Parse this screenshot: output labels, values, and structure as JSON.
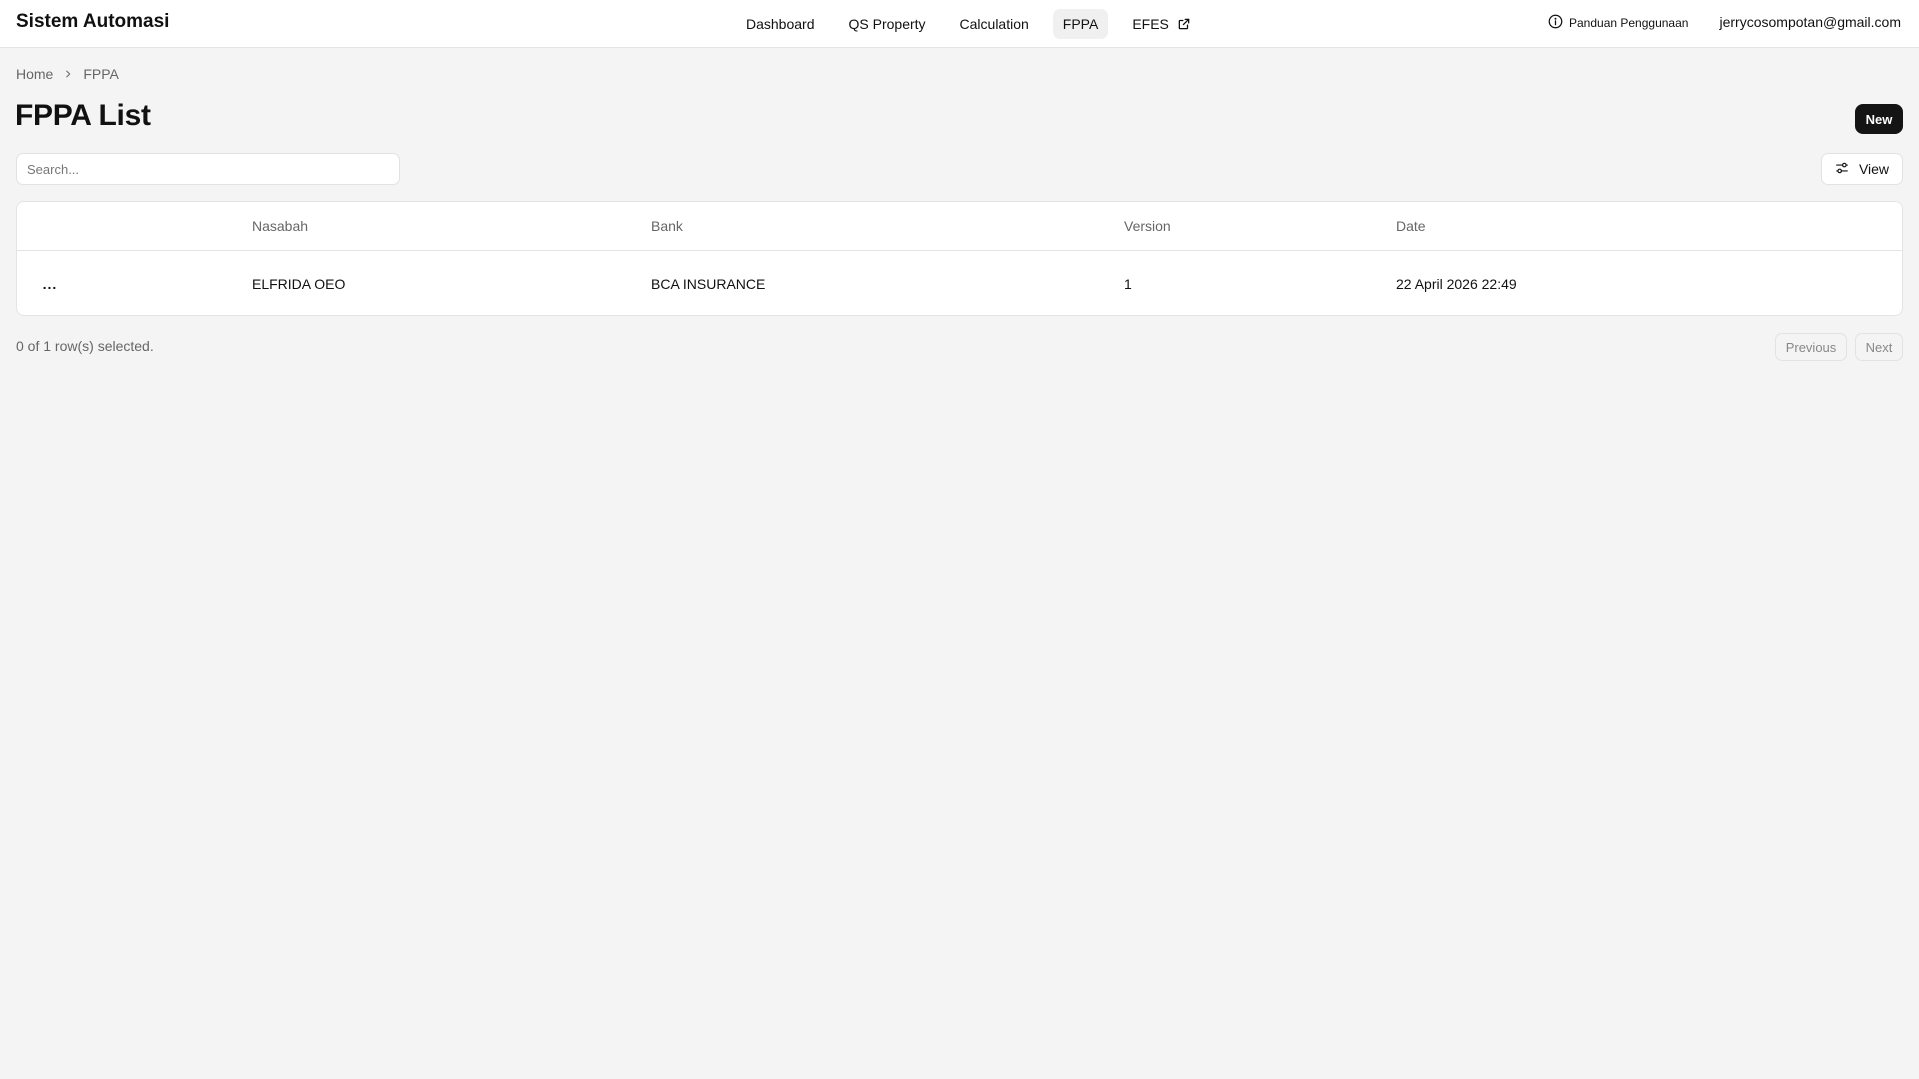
{
  "app": {
    "title": "Sistem Automasi"
  },
  "nav": {
    "items": [
      {
        "label": "Dashboard",
        "active": false
      },
      {
        "label": "QS Property",
        "active": false
      },
      {
        "label": "Calculation",
        "active": false
      },
      {
        "label": "FPPA",
        "active": true
      },
      {
        "label": "EFES",
        "active": false,
        "icon": "external-link-icon"
      }
    ]
  },
  "header": {
    "help_label": "Panduan Penggunaan",
    "help_icon": "info-circle-icon",
    "user_email": "jerrycosompotan@gmail.com"
  },
  "breadcrumb": {
    "home": "Home",
    "current": "FPPA"
  },
  "page": {
    "title": "FPPA List",
    "new_label": "New"
  },
  "toolbar": {
    "search_placeholder": "Search...",
    "search_value": "",
    "view_label": "View",
    "view_icon": "sliders-icon"
  },
  "table": {
    "columns": [
      "",
      "Nasabah",
      "Bank",
      "Version",
      "Date"
    ],
    "rows": [
      {
        "actions": "...",
        "nasabah": "ELFRIDA OEO",
        "bank": "BCA INSURANCE",
        "version": "1",
        "date": "22 April 2026 22:49"
      }
    ]
  },
  "footer": {
    "selection_text": "0 of 1 row(s) selected.",
    "previous_label": "Previous",
    "next_label": "Next"
  },
  "colors": {
    "background": "#f4f4f4",
    "primary_button": "#141414",
    "active_nav": "#f0f0f0"
  }
}
